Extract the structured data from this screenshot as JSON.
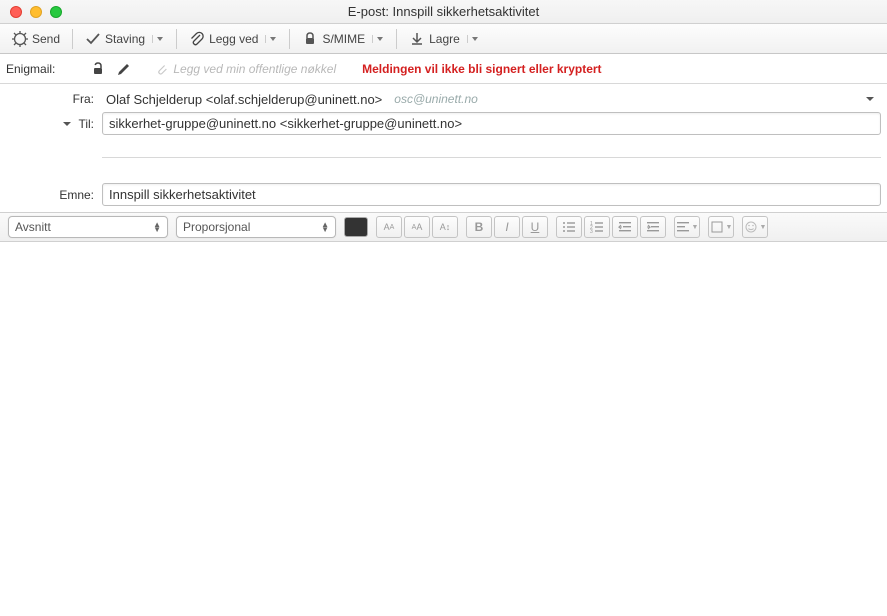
{
  "window": {
    "title": "E-post: Innspill sikkerhetsaktivitet"
  },
  "toolbar": {
    "send": "Send",
    "spelling": "Staving",
    "attach": "Legg ved",
    "smime": "S/MIME",
    "save": "Lagre"
  },
  "enigmail": {
    "label": "Enigmail:",
    "attach_key": "Legg ved min offentlige nøkkel",
    "warning": "Meldingen vil ikke bli signert eller kryptert"
  },
  "headers": {
    "from_label": "Fra:",
    "from_value": "Olaf Schjelderup <olaf.schjelderup@uninett.no>",
    "from_extra": "osc@uninett.no",
    "to_label": "Til:",
    "to_value": "sikkerhet-gruppe@uninett.no <sikkerhet-gruppe@uninett.no>",
    "subject_label": "Emne:",
    "subject_value": "Innspill sikkerhetsaktivitet"
  },
  "format": {
    "paragraph": "Avsnitt",
    "font": "Proporsjonal"
  }
}
